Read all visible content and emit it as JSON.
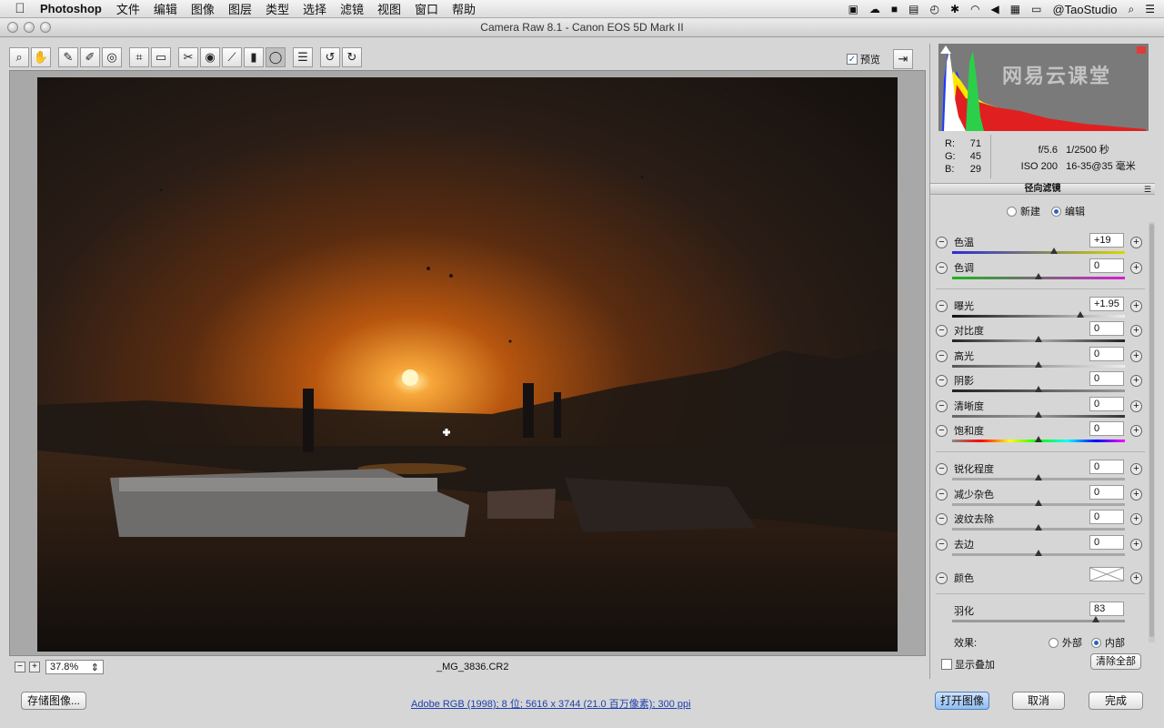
{
  "menubar": {
    "app": "Photoshop",
    "items": [
      "文件",
      "编辑",
      "图像",
      "图层",
      "类型",
      "选择",
      "滤镜",
      "视图",
      "窗口",
      "帮助"
    ],
    "user": "@TaoStudio"
  },
  "window": {
    "title": "Camera Raw 8.1 -  Canon EOS 5D Mark II"
  },
  "toolbar": {
    "preview_label": "预览",
    "preview_checked": true
  },
  "canvas": {
    "zoom": "37.8%",
    "filename": "_MG_3836.CR2"
  },
  "histogram": {
    "watermark": "网易云课堂"
  },
  "readout": {
    "r_label": "R:",
    "r": "71",
    "g_label": "G:",
    "g": "45",
    "b_label": "B:",
    "b": "29",
    "aperture": "f/5.6",
    "shutter": "1/2500 秒",
    "iso": "ISO 200",
    "lens": "16-35@35 毫米"
  },
  "panel": {
    "title": "径向滤镜",
    "mode_new": "新建",
    "mode_edit": "编辑",
    "mode_selected": "edit",
    "sliders": [
      {
        "label": "色温",
        "value": "+19",
        "pos": 0.59
      },
      {
        "label": "色调",
        "value": "0",
        "pos": 0.5
      },
      {
        "label": "曝光",
        "value": "+1.95",
        "pos": 0.74
      },
      {
        "label": "对比度",
        "value": "0",
        "pos": 0.5
      },
      {
        "label": "高光",
        "value": "0",
        "pos": 0.5
      },
      {
        "label": "阴影",
        "value": "0",
        "pos": 0.5
      },
      {
        "label": "清晰度",
        "value": "0",
        "pos": 0.5
      },
      {
        "label": "饱和度",
        "value": "0",
        "pos": 0.5
      },
      {
        "label": "锐化程度",
        "value": "0",
        "pos": 0.5
      },
      {
        "label": "减少杂色",
        "value": "0",
        "pos": 0.5
      },
      {
        "label": "波纹去除",
        "value": "0",
        "pos": 0.5
      },
      {
        "label": "去边",
        "value": "0",
        "pos": 0.5
      }
    ],
    "color_label": "颜色",
    "feather_label": "羽化",
    "feather_value": "83",
    "feather_pos": 0.83,
    "effect_label": "效果:",
    "effect_outside": "外部",
    "effect_inside": "内部",
    "effect_selected": "inside",
    "show_overlay": "显示叠加",
    "clear_all": "清除全部"
  },
  "bottom": {
    "save": "存储图像...",
    "workflow": "Adobe RGB (1998); 8 位; 5616 x 3744 (21.0 百万像素); 300 ppi",
    "open": "打开图像",
    "cancel": "取消",
    "done": "完成"
  },
  "icons": {
    "toolbar": [
      "zoom-icon",
      "hand-icon",
      "white-balance-icon",
      "color-sampler-icon",
      "targeted-adjust-icon",
      "crop-icon",
      "straighten-icon",
      "spot-removal-icon",
      "red-eye-icon",
      "adjustment-brush-icon",
      "graduated-filter-icon",
      "radial-filter-icon",
      "preferences-icon",
      "rotate-ccw-icon",
      "rotate-cw-icon"
    ]
  }
}
